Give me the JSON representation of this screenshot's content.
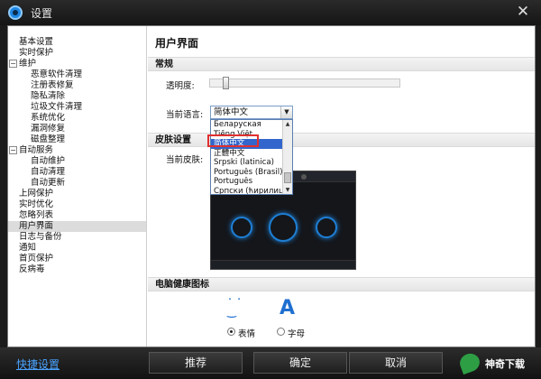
{
  "window": {
    "title": "设置",
    "close_glyph": "✕"
  },
  "nav": {
    "items": [
      {
        "label": "基本设置",
        "level": 0
      },
      {
        "label": "实时保护",
        "level": 0
      },
      {
        "label": "维护",
        "level": 0,
        "toggle": "−"
      },
      {
        "label": "恶意软件清理",
        "level": 1
      },
      {
        "label": "注册表修复",
        "level": 1
      },
      {
        "label": "隐私清除",
        "level": 1
      },
      {
        "label": "垃圾文件清理",
        "level": 1
      },
      {
        "label": "系统优化",
        "level": 1
      },
      {
        "label": "漏洞修复",
        "level": 1
      },
      {
        "label": "磁盘整理",
        "level": 1
      },
      {
        "label": "自动服务",
        "level": 0,
        "toggle": "−"
      },
      {
        "label": "自动维护",
        "level": 1
      },
      {
        "label": "自动清理",
        "level": 1
      },
      {
        "label": "自动更新",
        "level": 1
      },
      {
        "label": "上网保护",
        "level": 0
      },
      {
        "label": "实时优化",
        "level": 0
      },
      {
        "label": "忽略列表",
        "level": 0
      },
      {
        "label": "用户界面",
        "level": 0,
        "selected": true
      },
      {
        "label": "日志与备份",
        "level": 0
      },
      {
        "label": "通知",
        "level": 0
      },
      {
        "label": "首页保护",
        "level": 0
      },
      {
        "label": "反病毒",
        "level": 0
      }
    ]
  },
  "content": {
    "title": "用户界面",
    "general": {
      "header": "常规",
      "transparency_label": "透明度:",
      "transparency_level": 0.07,
      "language_label": "当前语言:",
      "language_value": "简体中文",
      "language_options": [
        "Беларуская",
        "Tiếng Việt",
        "简体中文",
        "正體中文",
        "Srpski (latinica)",
        "Português (Brasil)",
        "Português",
        "Српски (ћирилица)"
      ],
      "selected_option_index": 2
    },
    "skin": {
      "header": "皮肤设置",
      "current_label": "当前皮肤:"
    },
    "health_icon": {
      "header": "电脑健康图标",
      "icon_face": "˙ ˙\n‿",
      "icon_letter": "A",
      "option_emoji": "表情",
      "option_letter": "字母",
      "selected": "emoji"
    }
  },
  "footer": {
    "quick_settings": "快捷设置",
    "recommend": "推荐",
    "ok": "确定",
    "cancel": "取消",
    "brand": "神奇下载"
  },
  "colors": {
    "accent": "#1e6fd0",
    "selection": "#3366cc",
    "highlight": "#e03030",
    "link": "#4aa3ff"
  }
}
